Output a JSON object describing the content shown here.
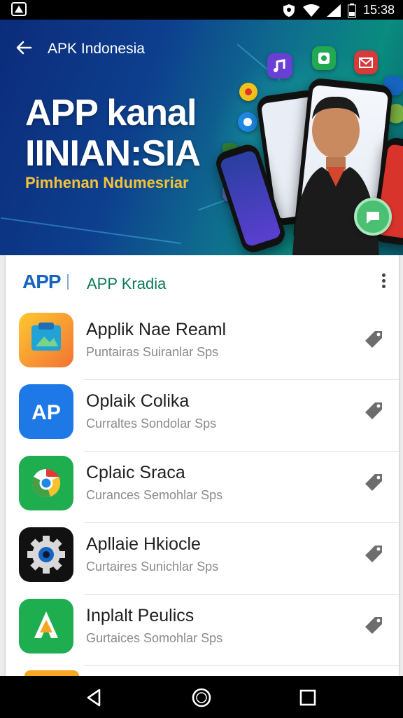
{
  "status_bar": {
    "time": "15:38"
  },
  "header": {
    "title": "APK Indonesia",
    "hero_title_line1": "APP kanal",
    "hero_title_line2": "IINIAN:SIA",
    "hero_subtitle": "Pimhenan Ndumesriar"
  },
  "card": {
    "logo_text": "APP",
    "app_name": "APP Kradia"
  },
  "apps": [
    {
      "title": "Applik Nae Reaml",
      "subtitle": "Puntairas Suiranlar Sps",
      "icon": "gallery-icon"
    },
    {
      "title": "Oplaik Colika",
      "subtitle": "Curraltes Sondolar Sps",
      "icon": "ap-icon"
    },
    {
      "title": "Cplaic Sraca",
      "subtitle": "Curances Semohlar Sps",
      "icon": "chrome-icon"
    },
    {
      "title": "Apllaie Hkiocle",
      "subtitle": "Curtaires Sunichlar Sps",
      "icon": "settings-gear-icon"
    },
    {
      "title": "Inplalt Peulics",
      "subtitle": "Gurtaices Somohlar Sps",
      "icon": "play-arrow-icon"
    }
  ],
  "colors": {
    "accent_green": "#0c7a59",
    "logo_blue": "#1565c0",
    "hero_subtitle": "#f3c33a"
  }
}
